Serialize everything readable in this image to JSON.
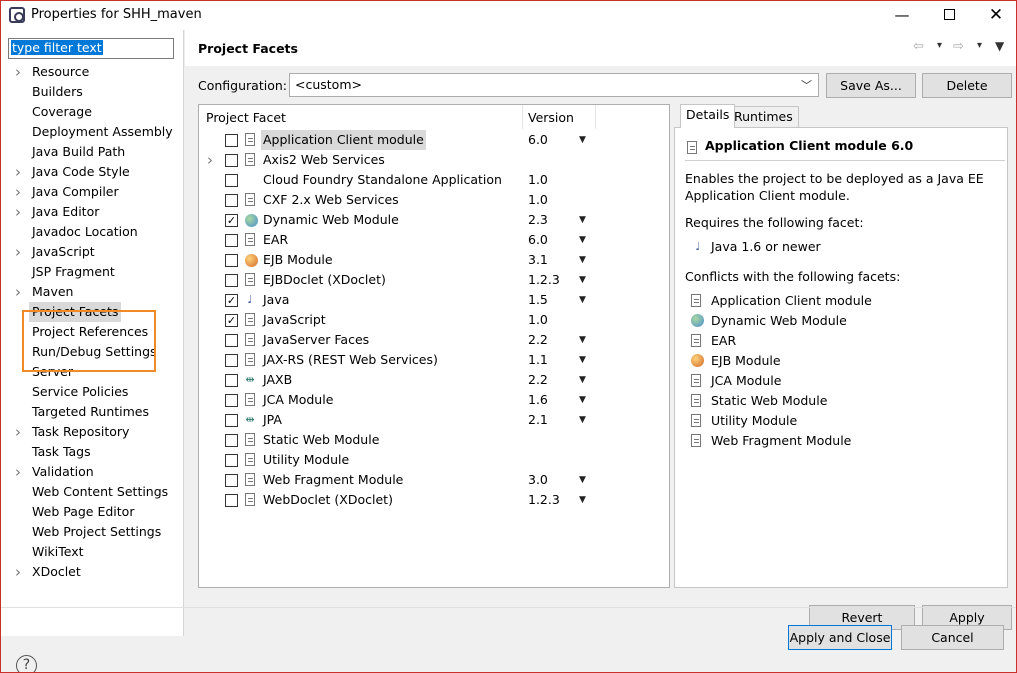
{
  "window": {
    "title": "Properties for SHH_maven",
    "minimize": "—",
    "close": "✕"
  },
  "filter": {
    "text": "type filter text"
  },
  "tree": [
    {
      "label": "Resource",
      "expandable": true
    },
    {
      "label": "Builders",
      "expandable": false
    },
    {
      "label": "Coverage",
      "expandable": false
    },
    {
      "label": "Deployment Assembly",
      "expandable": false
    },
    {
      "label": "Java Build Path",
      "expandable": false
    },
    {
      "label": "Java Code Style",
      "expandable": true
    },
    {
      "label": "Java Compiler",
      "expandable": true
    },
    {
      "label": "Java Editor",
      "expandable": true
    },
    {
      "label": "Javadoc Location",
      "expandable": false
    },
    {
      "label": "JavaScript",
      "expandable": true
    },
    {
      "label": "JSP Fragment",
      "expandable": false
    },
    {
      "label": "Maven",
      "expandable": true
    },
    {
      "label": "Project Facets",
      "expandable": false,
      "selected": true
    },
    {
      "label": "Project References",
      "expandable": false
    },
    {
      "label": "Run/Debug Settings",
      "expandable": false
    },
    {
      "label": "Server",
      "expandable": false
    },
    {
      "label": "Service Policies",
      "expandable": false
    },
    {
      "label": "Targeted Runtimes",
      "expandable": false
    },
    {
      "label": "Task Repository",
      "expandable": true
    },
    {
      "label": "Task Tags",
      "expandable": false
    },
    {
      "label": "Validation",
      "expandable": true
    },
    {
      "label": "Web Content Settings",
      "expandable": false
    },
    {
      "label": "Web Page Editor",
      "expandable": false
    },
    {
      "label": "Web Project Settings",
      "expandable": false
    },
    {
      "label": "WikiText",
      "expandable": false
    },
    {
      "label": "XDoclet",
      "expandable": true
    }
  ],
  "page": {
    "title": "Project Facets",
    "config_label": "Configuration:",
    "config_value": "<custom>",
    "save_as": "Save As...",
    "delete": "Delete"
  },
  "facets_table": {
    "col_facet": "Project Facet",
    "col_version": "Version",
    "rows": [
      {
        "name": "Application Client module",
        "version": "6.0",
        "checked": false,
        "dropdown": true,
        "icon": "doc",
        "selected": true
      },
      {
        "name": "Axis2 Web Services",
        "version": "",
        "checked": false,
        "dropdown": false,
        "icon": "doc",
        "expandable": true
      },
      {
        "name": "Cloud Foundry Standalone Application",
        "version": "1.0",
        "checked": false,
        "dropdown": false,
        "icon": "none"
      },
      {
        "name": "CXF 2.x Web Services",
        "version": "1.0",
        "checked": false,
        "dropdown": false,
        "icon": "doc"
      },
      {
        "name": "Dynamic Web Module",
        "version": "2.3",
        "checked": true,
        "dropdown": true,
        "icon": "globe"
      },
      {
        "name": "EAR",
        "version": "6.0",
        "checked": false,
        "dropdown": true,
        "icon": "doc"
      },
      {
        "name": "EJB Module",
        "version": "3.1",
        "checked": false,
        "dropdown": true,
        "icon": "bean"
      },
      {
        "name": "EJBDoclet (XDoclet)",
        "version": "1.2.3",
        "checked": false,
        "dropdown": true,
        "icon": "doc"
      },
      {
        "name": "Java",
        "version": "1.5",
        "checked": true,
        "dropdown": true,
        "icon": "java"
      },
      {
        "name": "JavaScript",
        "version": "1.0",
        "checked": true,
        "dropdown": false,
        "icon": "doc"
      },
      {
        "name": "JavaServer Faces",
        "version": "2.2",
        "checked": false,
        "dropdown": true,
        "icon": "doc"
      },
      {
        "name": "JAX-RS (REST Web Services)",
        "version": "1.1",
        "checked": false,
        "dropdown": true,
        "icon": "doc"
      },
      {
        "name": "JAXB",
        "version": "2.2",
        "checked": false,
        "dropdown": true,
        "icon": "arrows"
      },
      {
        "name": "JCA Module",
        "version": "1.6",
        "checked": false,
        "dropdown": true,
        "icon": "doc"
      },
      {
        "name": "JPA",
        "version": "2.1",
        "checked": false,
        "dropdown": true,
        "icon": "arrows"
      },
      {
        "name": "Static Web Module",
        "version": "",
        "checked": false,
        "dropdown": false,
        "icon": "doc"
      },
      {
        "name": "Utility Module",
        "version": "",
        "checked": false,
        "dropdown": false,
        "icon": "doc"
      },
      {
        "name": "Web Fragment Module",
        "version": "3.0",
        "checked": false,
        "dropdown": true,
        "icon": "doc"
      },
      {
        "name": "WebDoclet (XDoclet)",
        "version": "1.2.3",
        "checked": false,
        "dropdown": true,
        "icon": "doc"
      }
    ]
  },
  "details": {
    "tab_details": "Details",
    "tab_runtimes": "Runtimes",
    "title": "Application Client module 6.0",
    "description_line1": "Enables the project to be deployed as a Java EE",
    "description_line2": "Application Client module.",
    "requires_label": "Requires the following facet:",
    "requires": [
      {
        "label": "Java 1.6 or newer",
        "icon": "java"
      }
    ],
    "conflicts_label": "Conflicts with the following facets:",
    "conflicts": [
      {
        "label": "Application Client module",
        "icon": "doc"
      },
      {
        "label": "Dynamic Web Module",
        "icon": "globe"
      },
      {
        "label": "EAR",
        "icon": "doc"
      },
      {
        "label": "EJB Module",
        "icon": "bean"
      },
      {
        "label": "JCA Module",
        "icon": "doc"
      },
      {
        "label": "Static Web Module",
        "icon": "doc"
      },
      {
        "label": "Utility Module",
        "icon": "doc"
      },
      {
        "label": "Web Fragment Module",
        "icon": "doc"
      }
    ]
  },
  "buttons": {
    "revert": "Revert",
    "apply": "Apply",
    "apply_and_close": "Apply and Close",
    "cancel": "Cancel"
  },
  "help": "?"
}
